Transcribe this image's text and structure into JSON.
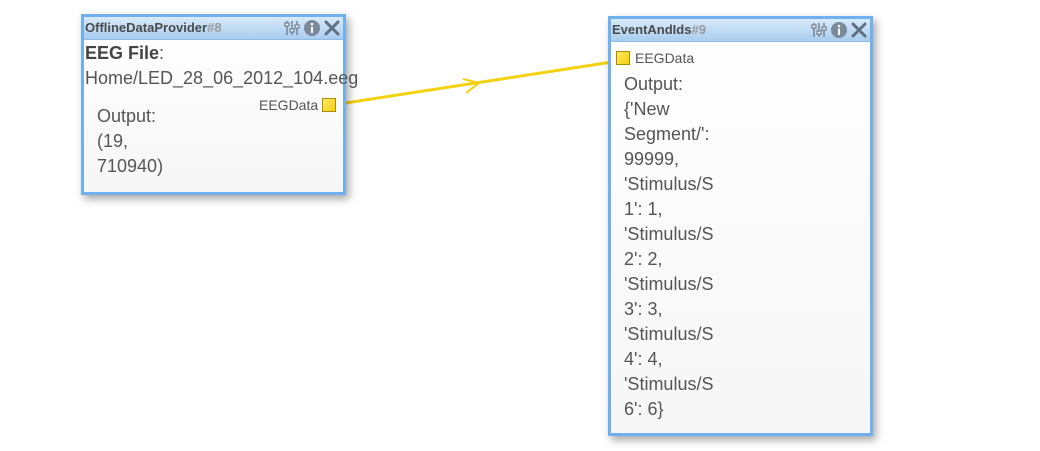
{
  "nodes": [
    {
      "title": "OfflineDataProvider",
      "id": "#8",
      "param_label": "EEG File",
      "param_colon": ":",
      "param_value": "Home/LED_28_06_2012_104.eeg",
      "output_label": "Output:",
      "output_lines": [
        "(19,",
        "710940)"
      ],
      "port_label": "EEGData"
    },
    {
      "title": "EventAndIds",
      "id": "#9",
      "port_label": "EEGData",
      "output_label": "Output:",
      "output_lines": [
        "{'New",
        "Segment/':",
        "99999,",
        "'Stimulus/S",
        "1': 1,",
        "'Stimulus/S",
        "2': 2,",
        "'Stimulus/S",
        "3': 3,",
        "'Stimulus/S",
        "4': 4,",
        "'Stimulus/S",
        "6': 6}"
      ]
    }
  ],
  "icons": {
    "settings": "sliders-icon",
    "info": "info-icon",
    "close": "close-icon"
  },
  "colors": {
    "node_border": "#6fb1ee",
    "header_top": "#d8eafb",
    "header_bottom": "#a9cdef",
    "wire": "#f5d20f",
    "port": "#f3cf10"
  }
}
